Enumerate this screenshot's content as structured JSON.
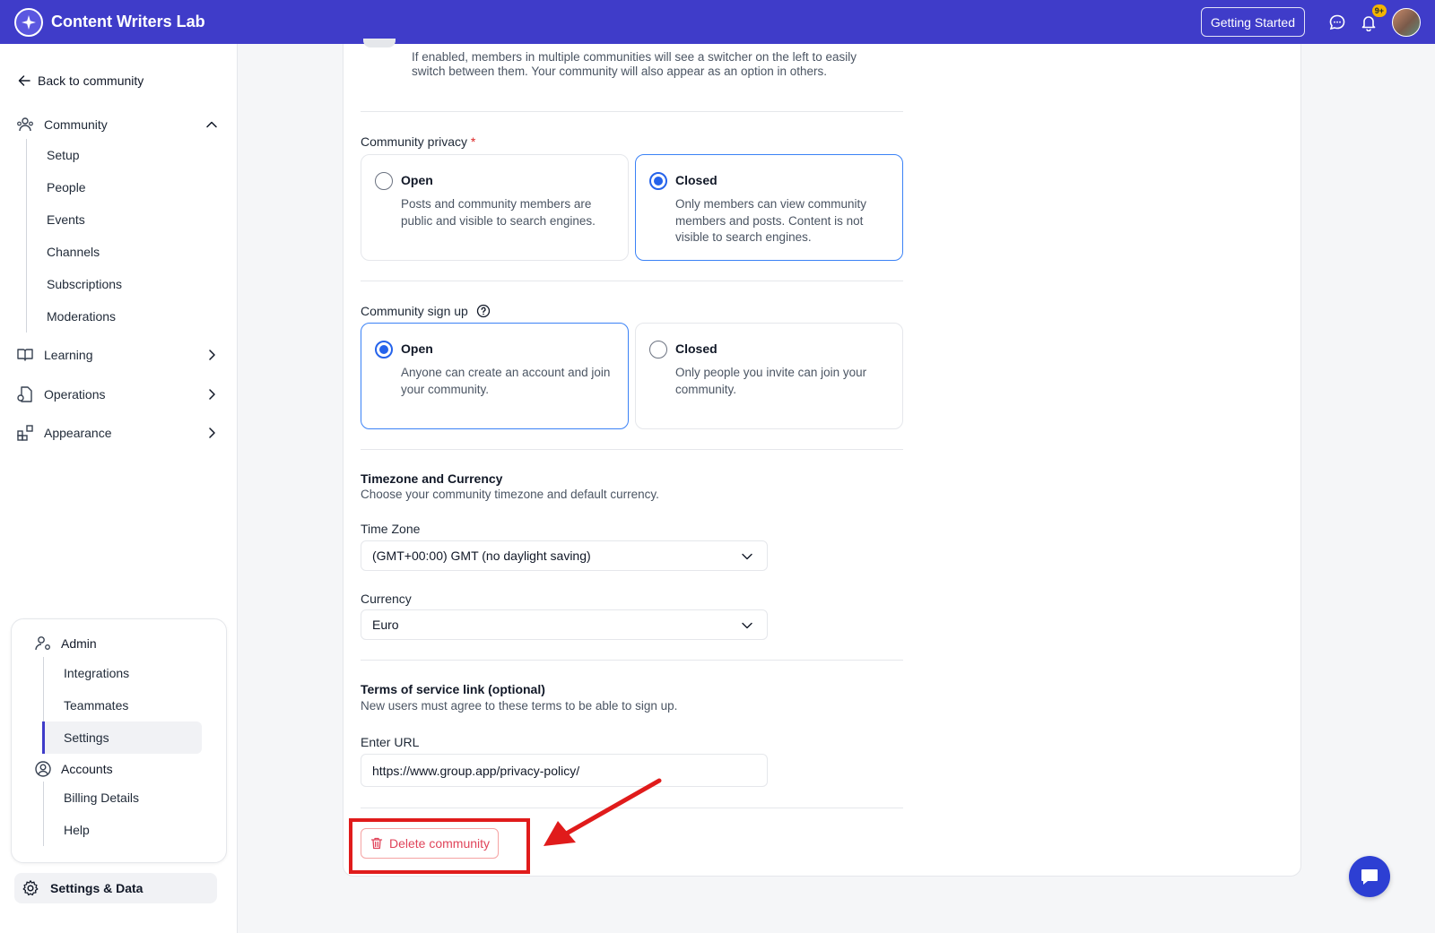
{
  "header": {
    "app_name": "Content Writers Lab",
    "getting_started_label": "Getting Started",
    "notification_badge": "9+",
    "brand_color": "#3f3cc9"
  },
  "sidebar": {
    "back_label": "Back to community",
    "groups": [
      {
        "label": "Community",
        "icon": "community-icon",
        "expanded": true,
        "items": [
          "Setup",
          "People",
          "Events",
          "Channels",
          "Subscriptions",
          "Moderations"
        ]
      },
      {
        "label": "Learning",
        "icon": "book-icon",
        "expanded": false
      },
      {
        "label": "Operations",
        "icon": "operations-icon",
        "expanded": false
      },
      {
        "label": "Appearance",
        "icon": "appearance-icon",
        "expanded": false
      }
    ],
    "admin": {
      "label": "Admin",
      "items": [
        "Integrations",
        "Teammates",
        "Settings"
      ],
      "active_item": "Settings"
    },
    "accounts": {
      "label": "Accounts",
      "items": [
        "Billing Details",
        "Help"
      ]
    },
    "settings_data_label": "Settings & Data"
  },
  "main": {
    "multi_community_desc": "If enabled, members in multiple communities will see a switcher on the left to easily switch between them. Your community will also appear as an option in others.",
    "privacy": {
      "label": "Community privacy",
      "required_mark": "*",
      "options": [
        {
          "title": "Open",
          "desc": "Posts and community members are public and visible to search engines.",
          "selected": false
        },
        {
          "title": "Closed",
          "desc": "Only members can view community members and posts. Content is not visible to search engines.",
          "selected": true
        }
      ]
    },
    "signup": {
      "label": "Community sign up",
      "options": [
        {
          "title": "Open",
          "desc": "Anyone can create an account and join your community.",
          "selected": true
        },
        {
          "title": "Closed",
          "desc": "Only people you invite can join your community.",
          "selected": false
        }
      ]
    },
    "timezone_currency": {
      "title": "Timezone and Currency",
      "desc": "Choose your community timezone and default currency.",
      "timezone_label": "Time Zone",
      "timezone_value": "(GMT+00:00) GMT (no daylight saving)",
      "currency_label": "Currency",
      "currency_value": "Euro"
    },
    "terms": {
      "title": "Terms of service link (optional)",
      "desc": "New users must agree to these terms to be able to sign up.",
      "url_label": "Enter URL",
      "url_value": "https://www.group.app/privacy-policy/"
    },
    "delete_label": "Delete community",
    "annotation_color": "#e01b1b"
  }
}
